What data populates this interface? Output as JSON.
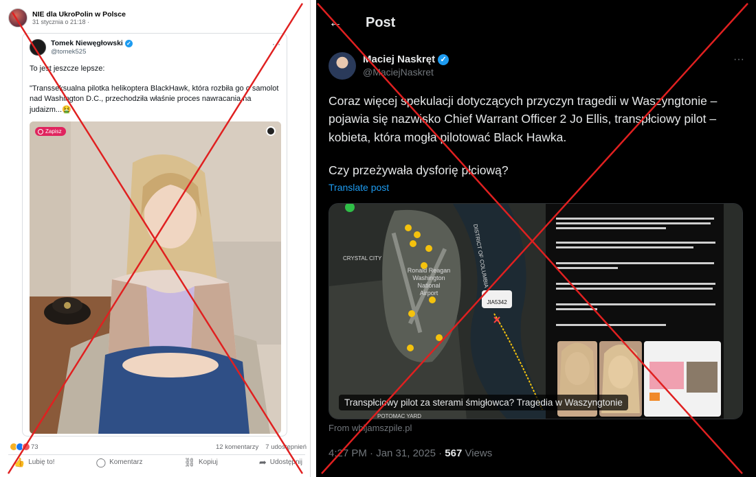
{
  "facebook": {
    "page_name": "NIE dla UkroPolin w Polsce",
    "date": "31 stycznia o 21:18 ·",
    "embedded_tweet": {
      "name": "Tomek Nieweglowski",
      "name_display": "Tomek Niewęgłowski",
      "handle": "@tomek525",
      "more": "···",
      "text_line1": "To jest jeszcze lepsze:",
      "text_quote": "\"Transseksualna pilotka helikoptera BlackHawk, która rozbiła go o samolot nad Washington D.C., przechodziła właśnie proces nawracania na judaizm...🤮"
    },
    "photo": {
      "save_label": "Zapisz"
    },
    "reactions_count": "73",
    "comments": "12 komentarzy",
    "shares": "7 udostępnień",
    "actions": {
      "like": "Lubię to!",
      "comment": "Komentarz",
      "copy": "Kopiuj",
      "share": "Udostępnij"
    }
  },
  "x_post": {
    "back_icon": "←",
    "header_title": "Post",
    "author_name": "Maciej Naskręt",
    "author_handle": "@MaciejNaskret",
    "more": "···",
    "text": "Coraz więcej spekulacji dotyczących przyczyn tragedii w Waszyngtonie – pojawia się nazwisko Chief Warrant Officer 2 Jo Ellis, transpłciowy pilot – kobieta, która mogła pilotować Black Hawka.",
    "question": "Czy przeżywała dysforię płciową?",
    "translate": "Translate post",
    "media": {
      "caption": "Transpłciowy pilot za sterami śmigłowca? Tragedia w Waszyngtonie",
      "map_labels": {
        "airport": "Ronald Reagan Washington National Airport",
        "district": "DISTRICT OF COLUMBIA",
        "flight": "JIA5342",
        "crystal_city": "CRYSTAL CITY",
        "potomac_yard": "POTOMAC YARD"
      },
      "screenshot_lines": [
        "So now we're learning that the Pilot/Co-Pilot 'female' who was on the Blackhawk is actually a transgender who wrote a long letter ONE DAY PRIOR about \"Gender dysphoria\" and depression.",
        "Identified as Chief warrant Officer 2 (CW2) Jo Ellis served in the Virginia National Guard for 15 years and transitioned while serving as a pilot.",
        "Jo Ellis has also been making radicalized statements about Trump on social media.",
        "Was this a suicide mission? That's what the flight radar data LITERALLY shows, almost colliding with 3 other planes before the final impact.",
        "And where's the best place to actually hit a plane mid air? Next to an airport.",
        "How are they going to cover this up?"
      ]
    },
    "source": "From wbijamszpile.pl",
    "time": "4:27 PM · Jan 31, 2025 · ",
    "views_count": "567",
    "views_label": " Views"
  },
  "colors": {
    "fb_link_blue": "#385898",
    "x_blue": "#1d9bf0",
    "overlay_red": "#e02020"
  }
}
